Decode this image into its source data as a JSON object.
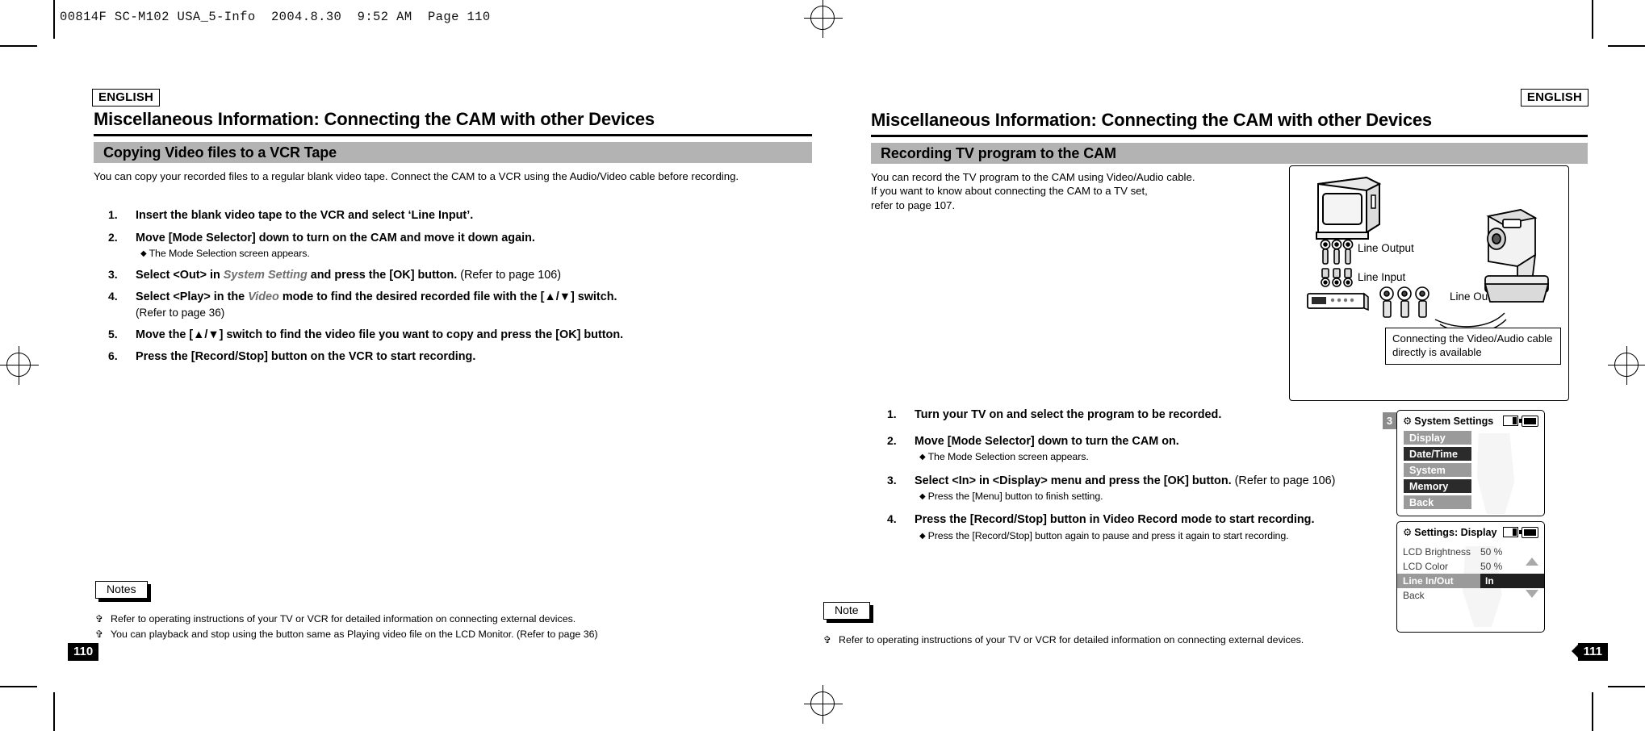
{
  "file_header": "00814F SC-M102 USA_5-Info  2004.8.30  9:52 AM  Page 110",
  "left_page": {
    "lang_badge": "ENGLISH",
    "chapter_title": "Miscellaneous Information: Connecting the CAM with other Devices",
    "section_title": "Copying Video files to a VCR Tape",
    "intro": "You can copy your recorded files to a regular blank video tape. Connect the CAM to a VCR using the Audio/Video cable before recording.",
    "steps": [
      {
        "num": "1.",
        "text": "Insert the blank video tape to the VCR and select ‘Line Input’."
      },
      {
        "num": "2.",
        "text": "Move [Mode Selector] down to turn on the CAM and move it down again.",
        "sub": "The Mode Selection screen appears."
      },
      {
        "num": "3.",
        "pre": "Select <Out> in ",
        "ital": "System Setting",
        "post": " and press the [OK] button.",
        "tail": " (Refer to page 106)"
      },
      {
        "num": "4.",
        "pre": "Select <Play> in the ",
        "ital": "Video",
        "post": " mode to find the desired recorded file with the [▲/▼] switch.",
        "cont": "(Refer to page 36)"
      },
      {
        "num": "5.",
        "text": "Move the [▲/▼] switch to find the video file you want to copy and press the [OK] button."
      },
      {
        "num": "6.",
        "text": "Press the [Record/Stop] button on the VCR to start recording."
      }
    ],
    "notes_tag": "Notes",
    "notes": [
      "Refer to operating instructions of your TV or VCR for detailed information on connecting external devices.",
      "You can playback and stop using the button same as Playing video file on the LCD Monitor. (Refer to page 36)"
    ],
    "folio": "110"
  },
  "right_page": {
    "lang_badge": "ENGLISH",
    "chapter_title": "Miscellaneous Information: Connecting the CAM with other Devices",
    "section_title": "Recording TV program to the CAM",
    "intro_lines": [
      "You can record the TV program to the CAM using Video/Audio cable.",
      "If you want to know about connecting the CAM to a TV set,",
      "refer to page 107."
    ],
    "figure": {
      "labels": [
        "Line Output",
        "Line Input",
        "Line Output"
      ],
      "callout": "Connecting the Video/Audio cable directly is available"
    },
    "steps": [
      {
        "num": "1.",
        "text": "Turn your TV on and select the program to be recorded."
      },
      {
        "num": "2.",
        "text": "Move [Mode Selector] down to turn the CAM on.",
        "sub": "The Mode Selection screen appears."
      },
      {
        "num": "3.",
        "text": "Select <In> in <Display> menu and press the [OK] button.",
        "tail": " (Refer to page 106)",
        "sub": "Press the [Menu] button to finish setting."
      },
      {
        "num": "4.",
        "text": "Press the [Record/Stop] button in Video Record mode to start recording.",
        "sub": "Press the [Record/Stop] button again to pause and press it again to start recording."
      }
    ],
    "lcd_system": {
      "step_badge": "3",
      "title": "System Settings",
      "items": [
        {
          "label": "Display",
          "style": "gray"
        },
        {
          "label": "Date/Time",
          "style": "dark"
        },
        {
          "label": "System",
          "style": "gray"
        },
        {
          "label": "Memory",
          "style": "dark"
        },
        {
          "label": "Back",
          "style": "gray"
        }
      ]
    },
    "lcd_display": {
      "title": "Settings: Display",
      "rows": [
        {
          "label": "LCD Brightness",
          "value": "50 %",
          "selected": false
        },
        {
          "label": "LCD Color",
          "value": "50 %",
          "selected": false
        },
        {
          "label": "Line In/Out",
          "value": "In",
          "selected": true
        },
        {
          "label": "Back",
          "value": "",
          "selected": false
        }
      ]
    },
    "note_tag": "Note",
    "notes": [
      "Refer to operating instructions of your TV or VCR for detailed information on connecting external devices."
    ],
    "folio": "111"
  }
}
